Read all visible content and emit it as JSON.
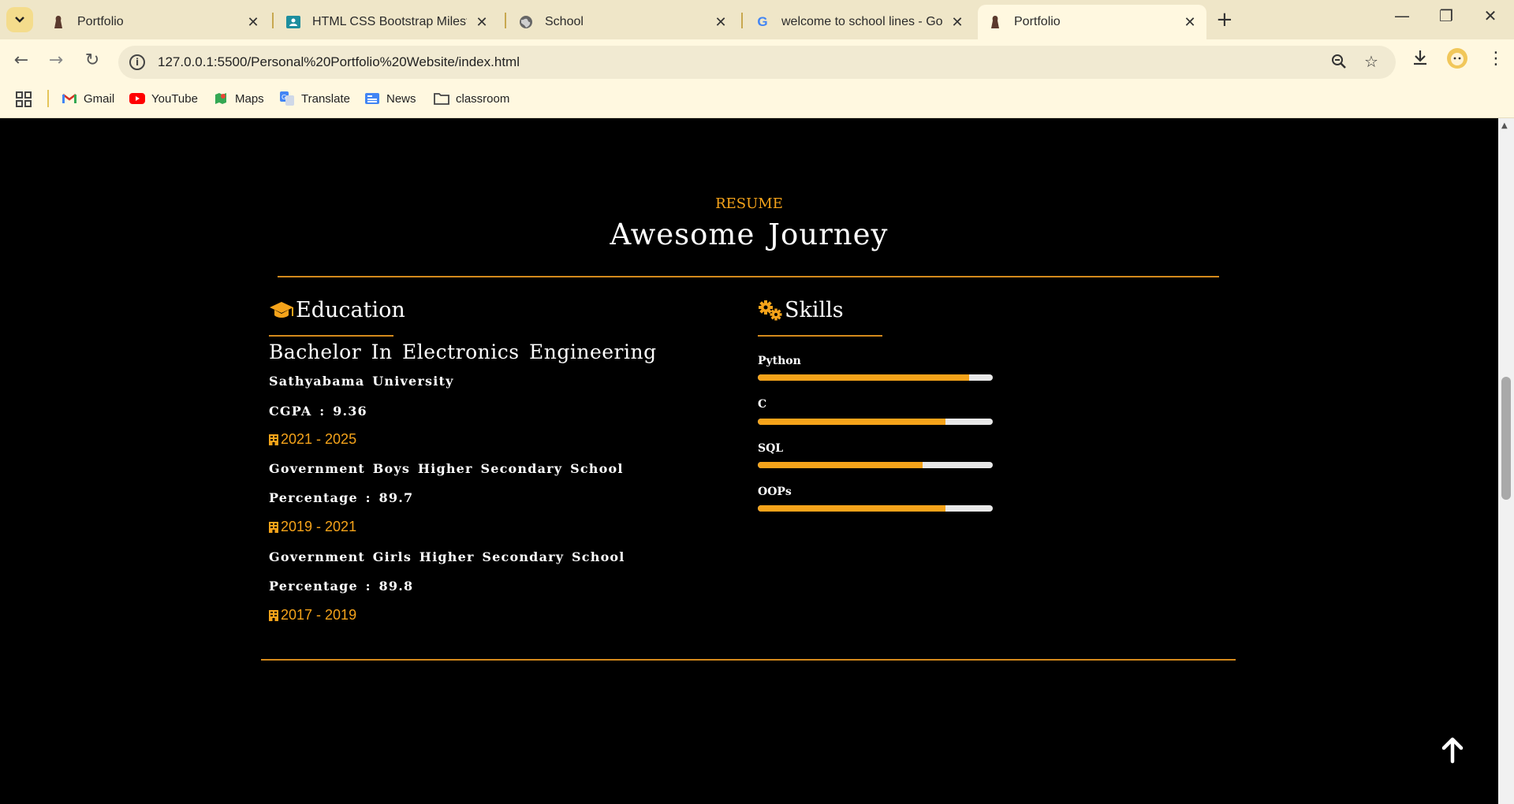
{
  "browser": {
    "tabs": [
      {
        "label": "Portfolio",
        "icon": "portfolio-favicon",
        "active": false
      },
      {
        "label": "HTML CSS Bootstrap Milestone",
        "icon": "classroom-favicon",
        "active": false
      },
      {
        "label": "School",
        "icon": "globe-favicon",
        "active": false
      },
      {
        "label": "welcome to school lines - Goog",
        "icon": "google-favicon",
        "active": false
      },
      {
        "label": "Portfolio",
        "icon": "portfolio-favicon",
        "active": true
      }
    ],
    "url": "127.0.0.1:5500/Personal%20Portfolio%20Website/index.html",
    "bookmarks": [
      {
        "label": "Gmail",
        "icon": "gmail-icon"
      },
      {
        "label": "YouTube",
        "icon": "youtube-icon"
      },
      {
        "label": "Maps",
        "icon": "maps-icon"
      },
      {
        "label": "Translate",
        "icon": "translate-icon"
      },
      {
        "label": "News",
        "icon": "news-icon"
      },
      {
        "label": "classroom",
        "icon": "folder-icon"
      }
    ]
  },
  "colors": {
    "accent": "#f5a31a",
    "background": "#000000",
    "text": "#ffffff",
    "track": "#e8e8e8"
  },
  "resume": {
    "label": "RESUME",
    "title": "Awesome Journey",
    "education": {
      "heading": "Education",
      "icon": "graduation-cap-icon",
      "degree": "Bachelor In Electronics Engineering",
      "entries": [
        {
          "school": "Sathyabama University",
          "score": "CGPA : 9.36",
          "years": "2021 - 2025"
        },
        {
          "school": "Government Boys Higher Secondary School",
          "score": "Percentage : 89.7",
          "years": "2019 - 2021"
        },
        {
          "school": "Government Girls Higher Secondary School",
          "score": "Percentage : 89.8",
          "years": "2017 - 2019"
        }
      ]
    },
    "skills": {
      "heading": "Skills",
      "icon": "gears-icon",
      "items": [
        {
          "name": "Python",
          "level": 0.9
        },
        {
          "name": "C",
          "level": 0.8
        },
        {
          "name": "SQL",
          "level": 0.7
        },
        {
          "name": "OOPs",
          "level": 0.8
        }
      ]
    }
  }
}
